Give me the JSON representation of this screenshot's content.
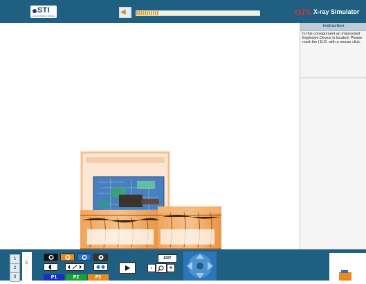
{
  "header": {
    "logo_text": "STI",
    "logo_subtext": "security training institute",
    "brand_text": "OTS",
    "app_title": "X-ray Simulator",
    "progress_fraction": 0.18
  },
  "panel": {
    "heading": "Instruction",
    "instruction_text": "In this consignment an Improvised Explosive Device is located. Please mark the I.E.D. with a mouse click."
  },
  "bottom": {
    "bag_tabs": [
      "1",
      "2",
      "3"
    ],
    "bag_marker": "G",
    "exit_label": "EXIT",
    "zoom_out_label": "-",
    "zoom_in_label": "+",
    "presets": [
      {
        "label": "P1",
        "color": "#1530c8"
      },
      {
        "label": "P2",
        "color": "#1aa12f"
      },
      {
        "label": "P3",
        "color": "#e88a1e"
      }
    ],
    "tool_icons": [
      "color-mode-icon",
      "organic-icon",
      "inorganic-icon",
      "high-penetration-icon",
      "black-white-icon",
      "edge-enhance-icon",
      "super-enhance-icon"
    ]
  },
  "colors": {
    "bar": "#1f5f82",
    "accent_orange": "#e88a1e",
    "brand_red": "#e2332a"
  }
}
